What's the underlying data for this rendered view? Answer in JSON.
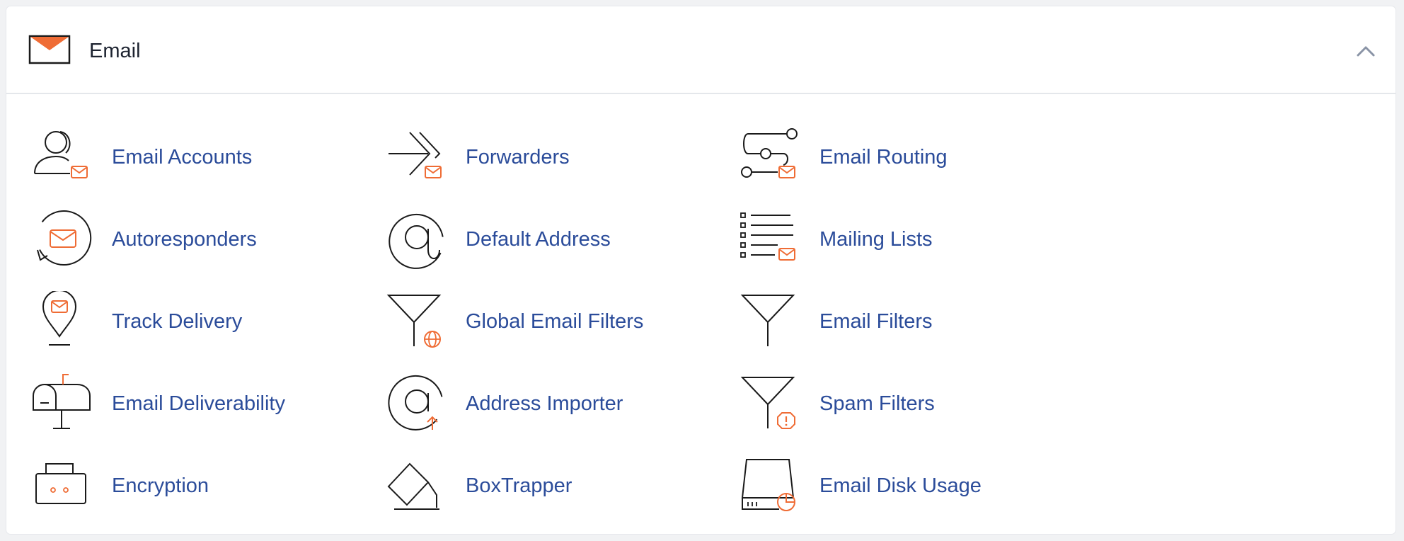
{
  "section": {
    "title": "Email",
    "collapse_icon": "chevron-up-icon"
  },
  "colors": {
    "link": "#2b4c9a",
    "accent": "#ef6c35",
    "stroke": "#1a1a1a"
  },
  "items": [
    {
      "label": "Email Accounts",
      "icon": "email-accounts-icon"
    },
    {
      "label": "Forwarders",
      "icon": "forwarders-icon"
    },
    {
      "label": "Email Routing",
      "icon": "email-routing-icon"
    },
    {
      "label": "Autoresponders",
      "icon": "autoresponders-icon"
    },
    {
      "label": "Default Address",
      "icon": "default-address-icon"
    },
    {
      "label": "Mailing Lists",
      "icon": "mailing-lists-icon"
    },
    {
      "label": "Track Delivery",
      "icon": "track-delivery-icon"
    },
    {
      "label": "Global Email Filters",
      "icon": "global-email-filters-icon"
    },
    {
      "label": "Email Filters",
      "icon": "email-filters-icon"
    },
    {
      "label": "Email Deliverability",
      "icon": "email-deliverability-icon"
    },
    {
      "label": "Address Importer",
      "icon": "address-importer-icon"
    },
    {
      "label": "Spam Filters",
      "icon": "spam-filters-icon"
    },
    {
      "label": "Encryption",
      "icon": "encryption-icon"
    },
    {
      "label": "BoxTrapper",
      "icon": "boxtrapper-icon"
    },
    {
      "label": "Email Disk Usage",
      "icon": "email-disk-usage-icon"
    }
  ]
}
